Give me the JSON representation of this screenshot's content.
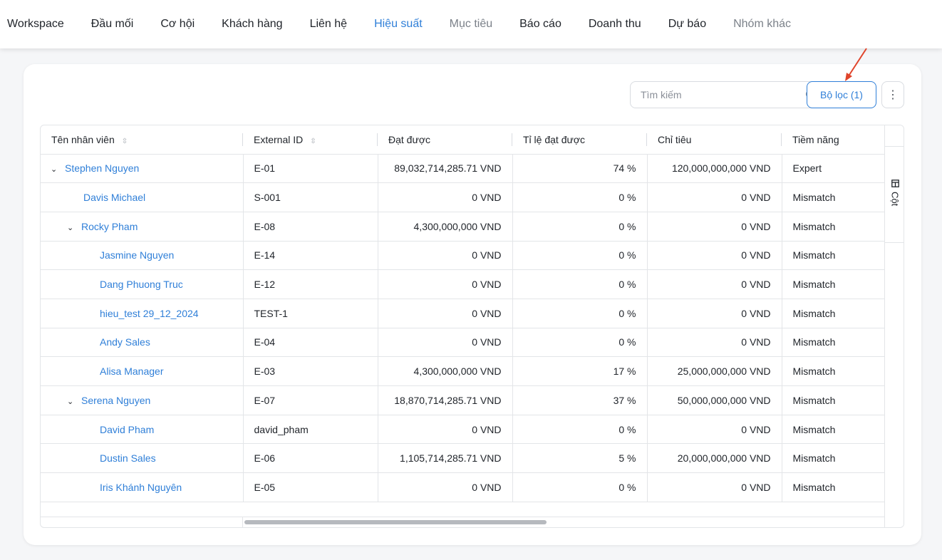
{
  "nav": {
    "items": [
      {
        "label": "Workspace",
        "state": "normal"
      },
      {
        "label": "Đầu mối",
        "state": "normal"
      },
      {
        "label": "Cơ hội",
        "state": "normal"
      },
      {
        "label": "Khách hàng",
        "state": "normal"
      },
      {
        "label": "Liên hệ",
        "state": "normal"
      },
      {
        "label": "Hiệu suất",
        "state": "active"
      },
      {
        "label": "Mục tiêu",
        "state": "muted"
      },
      {
        "label": "Báo cáo",
        "state": "normal"
      },
      {
        "label": "Doanh thu",
        "state": "normal"
      },
      {
        "label": "Dự báo",
        "state": "normal"
      },
      {
        "label": "Nhóm khác",
        "state": "muted"
      }
    ],
    "active_color": "#2f7fd8"
  },
  "toolbar": {
    "search_placeholder": "Tìm kiếm",
    "search_icon": "search-icon",
    "filter_label": "Bộ lọc (1)",
    "more_icon": "more-vertical-icon"
  },
  "table": {
    "columns": [
      "Tên nhân viên",
      "External ID",
      "Đạt được",
      "Tỉ lệ đạt được",
      "Chỉ tiêu",
      "Tiềm năng"
    ],
    "rows": [
      {
        "name": "Stephen Nguyen",
        "level": 0,
        "expanded": true,
        "id": "E-01",
        "achieved": "89,032,714,285.71 VND",
        "rate": "74 %",
        "target": "120,000,000,000 VND",
        "potential": "Expert"
      },
      {
        "name": "Davis Michael",
        "level": 1,
        "expanded": false,
        "id": "S-001",
        "achieved": "0 VND",
        "rate": "0 %",
        "target": "0 VND",
        "potential": "Mismatch"
      },
      {
        "name": "Rocky Pham",
        "level": 1,
        "expanded": true,
        "id": "E-08",
        "achieved": "4,300,000,000 VND",
        "rate": "0 %",
        "target": "0 VND",
        "potential": "Mismatch"
      },
      {
        "name": "Jasmine Nguyen",
        "level": 2,
        "expanded": false,
        "id": "E-14",
        "achieved": "0 VND",
        "rate": "0 %",
        "target": "0 VND",
        "potential": "Mismatch"
      },
      {
        "name": "Dang Phuong Truc",
        "level": 2,
        "expanded": false,
        "id": "E-12",
        "achieved": "0 VND",
        "rate": "0 %",
        "target": "0 VND",
        "potential": "Mismatch"
      },
      {
        "name": "hieu_test 29_12_2024",
        "level": 2,
        "expanded": false,
        "id": "TEST-1",
        "achieved": "0 VND",
        "rate": "0 %",
        "target": "0 VND",
        "potential": "Mismatch"
      },
      {
        "name": "Andy Sales",
        "level": 2,
        "expanded": false,
        "id": "E-04",
        "achieved": "0 VND",
        "rate": "0 %",
        "target": "0 VND",
        "potential": "Mismatch"
      },
      {
        "name": "Alisa Manager",
        "level": 2,
        "expanded": false,
        "id": "E-03",
        "achieved": "4,300,000,000 VND",
        "rate": "17 %",
        "target": "25,000,000,000 VND",
        "potential": "Mismatch"
      },
      {
        "name": "Serena Nguyen",
        "level": 1,
        "expanded": true,
        "id": "E-07",
        "achieved": "18,870,714,285.71 VND",
        "rate": "37 %",
        "target": "50,000,000,000 VND",
        "potential": "Mismatch"
      },
      {
        "name": "David Pham",
        "level": 2,
        "expanded": false,
        "id": "david_pham",
        "achieved": "0 VND",
        "rate": "0 %",
        "target": "0 VND",
        "potential": "Mismatch"
      },
      {
        "name": "Dustin Sales",
        "level": 2,
        "expanded": false,
        "id": "E-06",
        "achieved": "1,105,714,285.71 VND",
        "rate": "5 %",
        "target": "20,000,000,000 VND",
        "potential": "Mismatch"
      },
      {
        "name": "Iris Khánh Nguyên",
        "level": 2,
        "expanded": false,
        "id": "E-05",
        "achieved": "0 VND",
        "rate": "0 %",
        "target": "0 VND",
        "potential": "Mismatch"
      }
    ]
  },
  "side_panel": {
    "columns_label": "Cột",
    "columns_icon": "table-columns-icon"
  }
}
